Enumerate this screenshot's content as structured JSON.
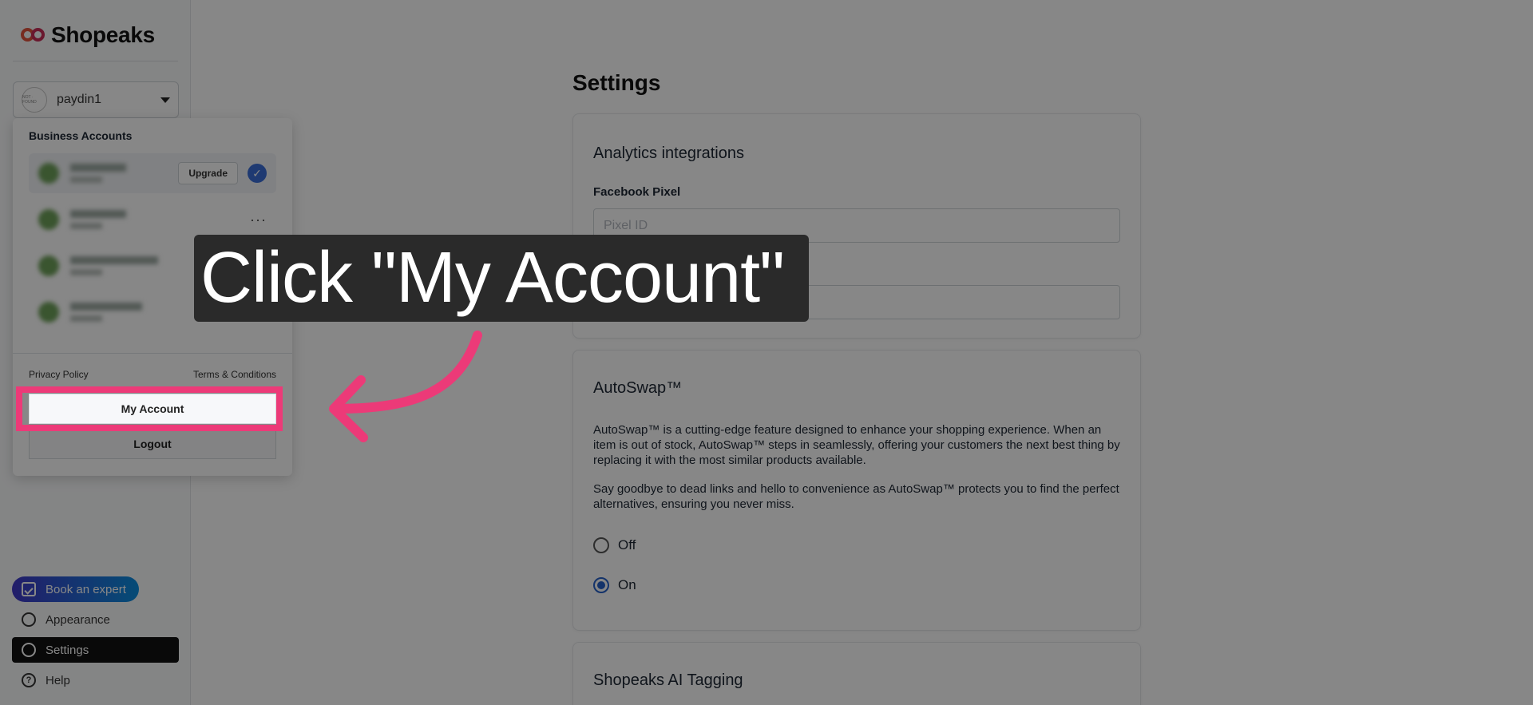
{
  "brand": {
    "name": "Shopeaks",
    "colors": [
      "#e0533e",
      "#c92f58"
    ]
  },
  "account_selector": {
    "name": "paydin1",
    "avatar_text": "NOT · FOUND"
  },
  "dropdown": {
    "title": "Business Accounts",
    "upgrade_label": "Upgrade",
    "more_label": "···",
    "privacy_label": "Privacy Policy",
    "terms_label": "Terms & Conditions",
    "my_account_label": "My Account",
    "logout_label": "Logout"
  },
  "nav": {
    "book_expert": "Book an expert",
    "appearance": "Appearance",
    "settings": "Settings",
    "help": "Help"
  },
  "main": {
    "title": "Settings",
    "analytics": {
      "title": "Analytics integrations",
      "facebook_label": "Facebook Pixel",
      "facebook_placeholder": "Pixel ID",
      "second_label": "",
      "second_placeholder": ""
    },
    "autoswap": {
      "title": "AutoSwap™",
      "para1": "AutoSwap™ is a cutting-edge feature designed to enhance your shopping experience. When an item is out of stock, AutoSwap™ steps in seamlessly, offering your customers the next best thing by replacing it with the most similar products available.",
      "para2": "Say goodbye to dead links and hello to convenience as AutoSwap™ protects you to find the perfect alternatives, ensuring you never miss.",
      "option_off": "Off",
      "option_on": "On",
      "selected": "On"
    },
    "tagging": {
      "title": "Shopeaks AI Tagging"
    }
  },
  "annotation": {
    "text": "Click \"My Account\"",
    "highlight_color": "#ec3a78"
  }
}
